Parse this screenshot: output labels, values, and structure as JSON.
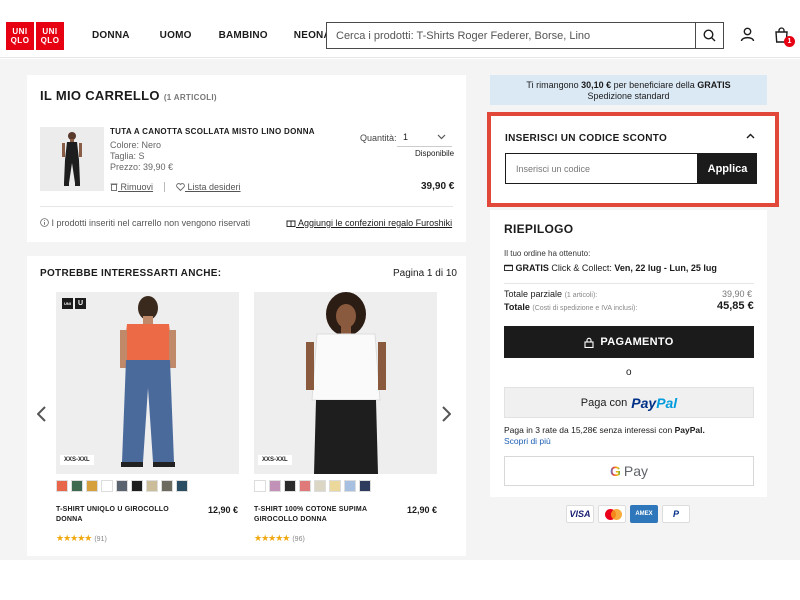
{
  "header": {
    "logo_top": "UNI",
    "logo_bottom": "QLO",
    "nav": [
      "DONNA",
      "UOMO",
      "BAMBINO",
      "NEONATO"
    ],
    "search_placeholder": "Cerca i prodotti: T-Shirts Roger Federer, Borse, Lino",
    "cart_badge": "1"
  },
  "cart": {
    "title": "IL MIO CARRELLO",
    "count": "(1 ARTICOLI)",
    "item": {
      "name": "TUTA A CANOTTA SCOLLATA MISTO LINO DONNA",
      "color": "Colore: Nero",
      "size": "Taglia: S",
      "price_label": "Prezzo: 39,90 €",
      "quantity_label": "Quantità:",
      "quantity_value": "1",
      "availability": "Disponibile",
      "remove": "Rimuovi",
      "wishlist": "Lista desideri",
      "total": "39,90 €"
    },
    "note": "I prodotti inseriti nel carrello non vengono riservati",
    "gift": "Aggiungi le confezioni regalo Furoshiki"
  },
  "recommendations": {
    "title": "POTREBBE INTERESSARTI ANCHE:",
    "page": "Pagina 1 di 10",
    "products": [
      {
        "name": "T-SHIRT UNIQLO U GIROCOLLO DONNA",
        "price": "12,90 €",
        "sizes": "XXS-XXL",
        "reviews": "(91)",
        "badge": [
          "UNI",
          "U"
        ],
        "swatches": [
          "#e8674a",
          "#3f6a4f",
          "#d6a03d",
          "#ffffff",
          "#5c6370",
          "#1e1e1e",
          "#cbbd9a",
          "#6d6a5f",
          "#2a4d63"
        ]
      },
      {
        "name": "T-SHIRT 100% COTONE SUPIMA GIROCOLLO DONNA",
        "price": "12,90 €",
        "sizes": "XXS-XXL",
        "reviews": "(96)",
        "swatches": [
          "#ffffff",
          "#c291b8",
          "#2b2b2b",
          "#e07a7a",
          "#dcd6c4",
          "#ecd89a",
          "#a7bfe0",
          "#2f3b5c"
        ]
      }
    ]
  },
  "notice": {
    "text_pre": "Ti rimangono",
    "amount": "30,10 €",
    "text_mid": "per beneficiare della",
    "gratis": "GRATIS",
    "text_post": "Spedizione standard"
  },
  "coupon": {
    "title": "INSERISCI UN CODICE SCONTO",
    "placeholder": "Inserisci un codice",
    "apply": "Applica"
  },
  "summary": {
    "title": "RIEPILOGO",
    "order_note": "Il tuo ordine ha ottenuto:",
    "click_gratis": "GRATIS",
    "click_text": "Click & Collect:",
    "click_dates": "Ven, 22 lug - Lun, 25 lug",
    "subtotal_label": "Totale parziale",
    "subtotal_small": "(1 articoli):",
    "subtotal_value": "39,90 €",
    "total_label": "Totale",
    "total_small": "(Costi di spedizione e IVA inclusi):",
    "total_value": "45,85 €",
    "pay_button": "PAGAMENTO",
    "or": "o",
    "paypal_prefix": "Paga con",
    "paypal_pay": "Pay",
    "paypal_pal": "Pal",
    "installments_pre": "Paga in 3 rate da 15,28€ senza interessi con",
    "installments_brand": "PayPal.",
    "learn_more": "Scopri di più",
    "gpay": "Pay"
  },
  "payment_cards": [
    "VISA",
    "AMEX",
    "P"
  ]
}
